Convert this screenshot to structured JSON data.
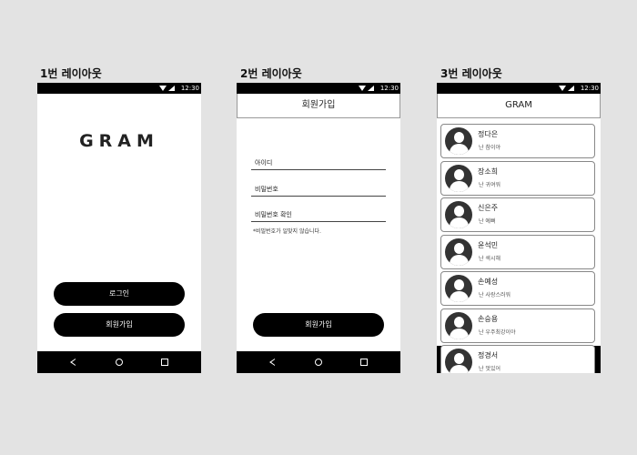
{
  "layouts": [
    {
      "title": "1번 레이아웃"
    },
    {
      "title": "2번 레이아웃"
    },
    {
      "title": "3번 레이아웃"
    }
  ],
  "status_time": "12:30",
  "screen1": {
    "logo": "GRAM",
    "login_label": "로그인",
    "signup_label": "회원가입"
  },
  "screen2": {
    "header": "회원가입",
    "id_placeholder": "아이디",
    "password_placeholder": "비밀번호",
    "password_confirm_placeholder": "비밀번호 확인",
    "mismatch_hint": "*비밀번호가 일맞지 않습니다.",
    "submit_label": "회원가입"
  },
  "screen3": {
    "header": "GRAM",
    "users": [
      {
        "name": "정다은",
        "status": "난 참이야"
      },
      {
        "name": "장소희",
        "status": "난 귀여워"
      },
      {
        "name": "신은주",
        "status": "난 예뻐"
      },
      {
        "name": "윤석민",
        "status": "난 섹시해"
      },
      {
        "name": "손예성",
        "status": "난 사랑스러워"
      },
      {
        "name": "손승용",
        "status": "난 우주최강이야"
      },
      {
        "name": "정경서",
        "status": "난 멋있어"
      }
    ]
  }
}
